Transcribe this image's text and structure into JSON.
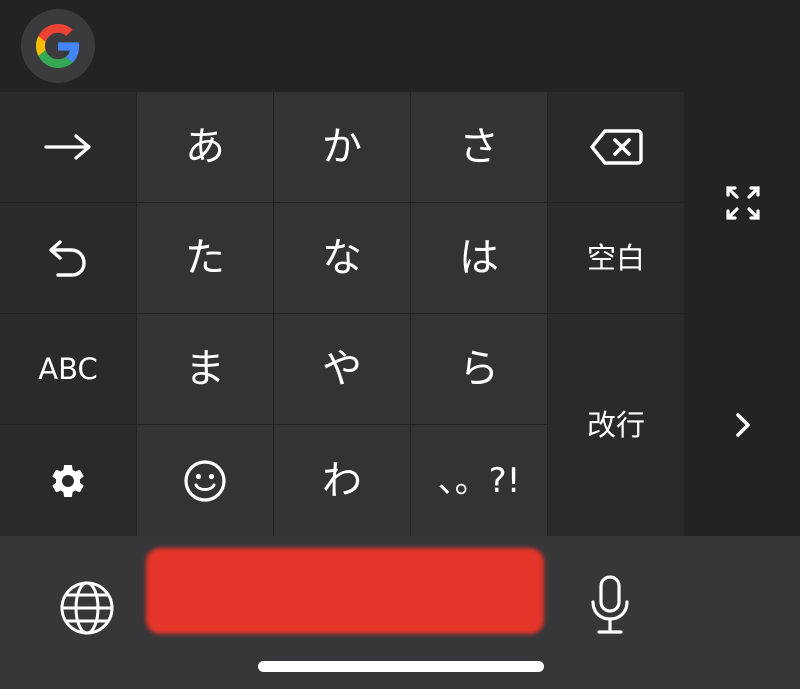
{
  "keyboard": {
    "left_column": {
      "next_icon": "arrow-right-icon",
      "undo_icon": "undo-icon",
      "abc_label": "ABC",
      "settings_icon": "gear-icon"
    },
    "kana_rows": [
      [
        "あ",
        "か",
        "さ"
      ],
      [
        "た",
        "な",
        "は"
      ],
      [
        "ま",
        "や",
        "ら"
      ],
      [
        "smiley-icon",
        "わ",
        "、。?!"
      ]
    ],
    "right_column": {
      "backspace_icon": "backspace-icon",
      "space_label": "空白",
      "enter_label": "改行"
    },
    "edge_column": {
      "expand_icon": "expand-icon",
      "chevron_icon": "chevron-right-icon"
    }
  },
  "top_bar": {
    "google_icon": "google-g-icon"
  },
  "bottom_bar": {
    "globe_icon": "globe-icon",
    "mic_icon": "microphone-icon"
  },
  "colors": {
    "background": "#232323",
    "kana_key": "#333333",
    "side_key": "#2a2a2a",
    "bottom_bar": "#37373a",
    "redaction": "#e5352a",
    "google_blue": "#4285F4",
    "google_red": "#EA4335",
    "google_yellow": "#FBBC05",
    "google_green": "#34A853"
  }
}
